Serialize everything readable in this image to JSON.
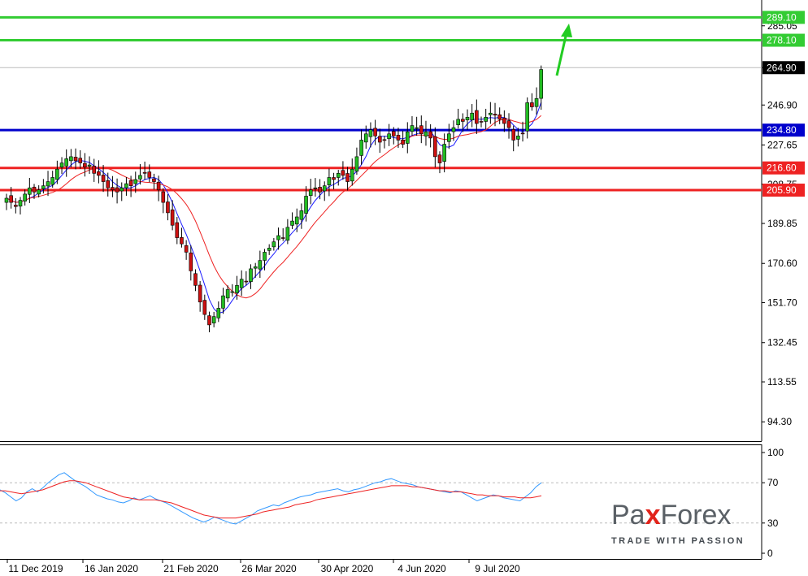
{
  "chart_data": [
    {
      "type": "candlestick",
      "title": "",
      "y_ticks": [
        "285.05",
        "264.90",
        "246.90",
        "227.65",
        "208.75",
        "189.85",
        "170.60",
        "151.70",
        "132.45",
        "113.55",
        "94.30"
      ],
      "x_ticks": [
        "11 Dec 2019",
        "16 Jan 2020",
        "21 Feb 2020",
        "26 Mar 2020",
        "30 Apr 2020",
        "4 Jun 2020",
        "9 Jul 2020"
      ],
      "ylim": [
        85.0,
        292.0
      ],
      "current_price": "264.90",
      "levels": [
        {
          "value": 289.1,
          "label": "289.10",
          "color": "#33cc33",
          "kind": "resistance"
        },
        {
          "value": 278.1,
          "label": "278.10",
          "color": "#33cc33",
          "kind": "resistance"
        },
        {
          "value": 234.8,
          "label": "234.80",
          "color": "#0000cc",
          "kind": "pivot"
        },
        {
          "value": 216.6,
          "label": "216.60",
          "color": "#ee2222",
          "kind": "support"
        },
        {
          "value": 205.9,
          "label": "205.90",
          "color": "#ee2222",
          "kind": "support"
        }
      ],
      "moving_averages": [
        {
          "color": "#1a1aff"
        },
        {
          "color": "#ee2222"
        }
      ],
      "close_series": [
        202,
        200,
        198,
        201,
        204,
        207,
        205,
        206,
        208,
        210,
        212,
        216,
        219,
        221,
        222,
        220,
        219,
        217,
        218,
        214,
        213,
        210,
        207,
        206,
        205,
        207,
        209,
        208,
        211,
        213,
        214,
        212,
        210,
        206,
        200,
        195,
        189,
        183,
        180,
        176,
        167,
        160,
        152,
        146,
        141,
        145,
        149,
        155,
        158,
        157,
        160,
        163,
        162,
        168,
        169,
        172,
        176,
        178,
        181,
        184,
        183,
        188,
        191,
        193,
        196,
        203,
        206,
        207,
        205,
        208,
        212,
        211,
        214,
        213,
        210,
        216,
        222,
        230,
        233,
        235,
        232,
        229,
        230,
        233,
        232,
        230,
        228,
        234,
        237,
        236,
        233,
        234,
        231,
        222,
        219,
        228,
        233,
        236,
        240,
        239,
        241,
        243,
        238,
        239,
        241,
        243,
        242,
        240,
        238,
        236,
        230,
        232,
        233,
        248,
        246,
        250,
        264
      ],
      "arrow": {
        "direction": "up",
        "color": "#22cc22"
      }
    },
    {
      "type": "line",
      "indicator": "oscillator",
      "y_ticks": [
        "100",
        "70",
        "30",
        "0"
      ],
      "ylim": [
        0,
        100
      ],
      "dashed_levels": [
        70,
        30
      ],
      "series": [
        {
          "color": "#3399ff",
          "values": [
            63,
            60,
            56,
            52,
            55,
            61,
            64,
            61,
            65,
            70,
            74,
            78,
            80,
            76,
            72,
            69,
            66,
            62,
            58,
            56,
            54,
            53,
            51,
            50,
            52,
            55,
            53,
            55,
            57,
            54,
            52,
            50,
            47,
            44,
            41,
            38,
            35,
            33,
            31,
            33,
            36,
            34,
            32,
            30,
            29,
            32,
            35,
            38,
            42,
            44,
            46,
            48,
            47,
            50,
            52,
            54,
            56,
            57,
            58,
            60,
            61,
            62,
            63,
            64,
            62,
            61,
            63,
            64,
            66,
            68,
            70,
            71,
            73,
            74,
            72,
            70,
            69,
            68,
            66,
            65,
            64,
            63,
            62,
            61,
            60,
            62,
            61,
            58,
            55,
            52,
            54,
            56,
            58,
            57,
            55,
            54,
            53,
            52,
            56,
            60,
            66,
            70
          ]
        },
        {
          "color": "#ee2222",
          "values": [
            62,
            62,
            61,
            60,
            59,
            60,
            61,
            62,
            63,
            65,
            67,
            69,
            71,
            72,
            72,
            71,
            70,
            68,
            66,
            64,
            62,
            60,
            58,
            56,
            55,
            54,
            53,
            53,
            53,
            53,
            52,
            51,
            50,
            48,
            46,
            44,
            42,
            40,
            38,
            37,
            36,
            35,
            35,
            35,
            35,
            36,
            37,
            38,
            39,
            41,
            42,
            43,
            44,
            45,
            46,
            48,
            49,
            50,
            51,
            53,
            54,
            55,
            56,
            57,
            58,
            59,
            60,
            61,
            62,
            63,
            64,
            65,
            66,
            67,
            67,
            67,
            67,
            66,
            66,
            65,
            64,
            63,
            62,
            62,
            61,
            61,
            61,
            60,
            59,
            58,
            58,
            57,
            57,
            57,
            56,
            56,
            56,
            55,
            55,
            55,
            56,
            57
          ]
        }
      ]
    }
  ],
  "logo": {
    "part1": "Pa",
    "x_letter": "x",
    "part2": "Forex",
    "tagline": "TRADE WITH PASSION"
  }
}
